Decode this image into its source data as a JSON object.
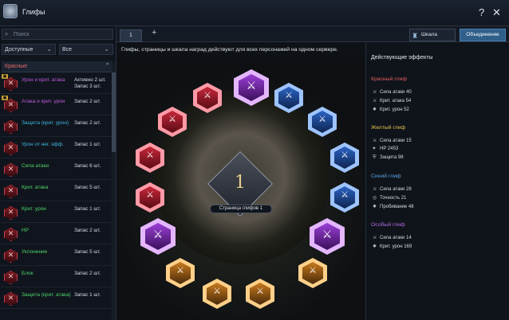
{
  "window": {
    "title": "Глифы",
    "help": "?",
    "close": "✕"
  },
  "left_panel": {
    "search_placeholder": "Поиск",
    "filter1": "Доступные",
    "filter2": "Все",
    "category": "Красные",
    "items": [
      {
        "name": "Урон и крит. атака",
        "status": "Активно 2 шт.\nЗапас 3 шт.",
        "color": "#c05adf",
        "locked": true
      },
      {
        "name": "Атака и крит. урон",
        "status": "Запас 2 шт.",
        "color": "#c05adf",
        "locked": true
      },
      {
        "name": "Защита (крит. урон)",
        "status": "Запас 2 шт.",
        "color": "#3fb6e0",
        "locked": false
      },
      {
        "name": "Урон от нег. эфф.",
        "status": "Запас 1 шт.",
        "color": "#3fb6e0",
        "locked": false
      },
      {
        "name": "Сила атаки",
        "status": "Запас 6 шт.",
        "color": "#4fd36a",
        "locked": false
      },
      {
        "name": "Крит. атака",
        "status": "Запас 5 шт.",
        "color": "#4fd36a",
        "locked": false
      },
      {
        "name": "Крит. урон",
        "status": "Запас 1 шт.",
        "color": "#4fd36a",
        "locked": false
      },
      {
        "name": "HP",
        "status": "Запас 2 шт.",
        "color": "#4fd36a",
        "locked": false
      },
      {
        "name": "Уклонение",
        "status": "Запас 5 шт.",
        "color": "#4fd36a",
        "locked": false
      },
      {
        "name": "Блок",
        "status": "Запас 2 шт.",
        "color": "#4fd36a",
        "locked": false
      },
      {
        "name": "Защита (крит. атака)",
        "status": "Запас 1 шт.",
        "color": "#4fd36a",
        "locked": false
      }
    ]
  },
  "tabs": {
    "page1": "1",
    "add": "+"
  },
  "buttons": {
    "reward": "Шкала наград",
    "merge": "Объединение"
  },
  "notice": "Глифы, страницы и шкала наград действуют для всех персонажей на одном сервере.",
  "board": {
    "page_number": "1",
    "page_label": "Страница глифов 1"
  },
  "effects": {
    "title": "Действующие эффекты",
    "sections": [
      {
        "name": "Красный глиф",
        "color": "#e35d5d",
        "lines": [
          {
            "icon": "swords-icon",
            "text": "Сила атаки 40"
          },
          {
            "icon": "swords-icon",
            "text": "Крит. атака 54"
          },
          {
            "icon": "burst-icon",
            "text": "Крит. урон 52"
          }
        ]
      },
      {
        "name": "Желтый глиф",
        "color": "#e6c04f",
        "lines": [
          {
            "icon": "swords-icon",
            "text": "Сила атаки 15"
          },
          {
            "icon": "heart-icon",
            "text": "HP 2453"
          },
          {
            "icon": "shield-icon",
            "text": "Защита 98"
          }
        ]
      },
      {
        "name": "Синий глиф",
        "color": "#5aa0e0",
        "lines": [
          {
            "icon": "swords-icon",
            "text": "Сила атаки 28"
          },
          {
            "icon": "target-icon",
            "text": "Точность 21"
          },
          {
            "icon": "burst-icon",
            "text": "Пробивание 48"
          }
        ]
      },
      {
        "name": "Особый глиф",
        "color": "#b46ae0",
        "lines": [
          {
            "icon": "swords-icon",
            "text": "Сила атаки 14"
          },
          {
            "icon": "burst-icon",
            "text": "Крит. урон 169"
          }
        ]
      }
    ]
  }
}
